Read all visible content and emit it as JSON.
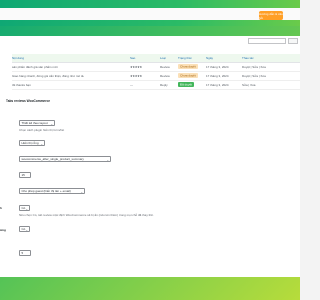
{
  "header": {
    "guide_button": "Hướng dẫn & câu hỏi"
  },
  "table": {
    "columns": [
      "Nội dung",
      "Sao",
      "Loại",
      "Trạng thái",
      "Ngày",
      "Thao tác"
    ],
    "rows": [
      {
        "content": "sản phẩm đánh giá sản phẩm mới",
        "stars": "★★★★★",
        "type": "Review",
        "status": "Chưa duyệt",
        "status_kind": "pending",
        "date": "17 tháng 3, 2024",
        "actions": "Duyệt | Sửa | Xóa"
      },
      {
        "content": "Giao hàng nhanh, đóng gói cẩn thận, đúng như mô tả.",
        "stars": "★★★★★",
        "type": "Review",
        "status": "Chưa duyệt",
        "status_kind": "pending",
        "date": "17 tháng 3, 2024",
        "actions": "Duyệt | Sửa | Xóa"
      },
      {
        "content": "tốt thanks bạn",
        "stars": "—",
        "type": "Reply",
        "status": "Đã duyệt",
        "status_kind": "approved",
        "date": "17 tháng 3, 2024",
        "actions": "Sửa | Xóa"
      }
    ]
  },
  "form": {
    "tab_label": "Tabs reviews WooCommerce",
    "fields": [
      {
        "value": "Thiết kế theo layout",
        "desc": "Chọn cách plugin hiển thị form/list"
      },
      {
        "value": "Hiển thị rỗng",
        "desc": ""
      },
      {
        "value": "woocommerce_after_single_product_summary",
        "desc": ""
      },
      {
        "value": "15",
        "desc": ""
      },
      {
        "value": "Cho phép guest (hiển thị tên + email)",
        "desc": ""
      },
      {
        "value": "Có",
        "desc": "Nếu chọn Có, tab review mặc định WooCommerce sẽ bị ẩn (nếu tên thêm) trong mọi chỗ đã thay thế."
      },
      {
        "value": "Có",
        "desc": ""
      },
      {
        "value": "5",
        "desc": ""
      }
    ],
    "side_labels": [
      "h",
      "ừng"
    ]
  },
  "colors": {
    "brand": "#0fa874",
    "accent": "#ff9f26",
    "approved": "#43b65b"
  }
}
